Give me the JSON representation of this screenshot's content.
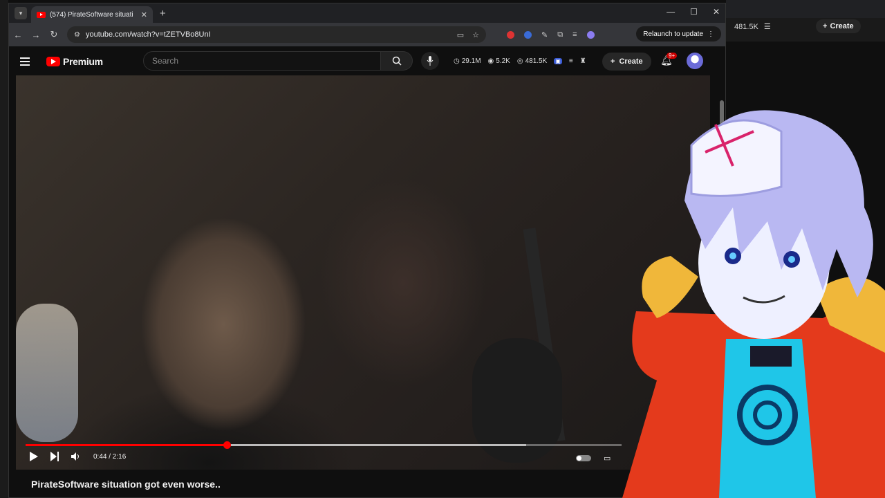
{
  "browser": {
    "tab_title": "(574) PirateSoftware situati",
    "url": "youtube.com/watch?v=tZETVBo8UnI",
    "relaunch_label": "Relaunch to update"
  },
  "youtube": {
    "logo_text": "Premium",
    "search_placeholder": "Search",
    "stats": {
      "views": "29.1M",
      "likes": "5.2K",
      "subs": "481.5K"
    },
    "create_label": "Create",
    "notification_badge": "9+"
  },
  "background_window": {
    "stat": "481.5K",
    "create_label": "Create"
  },
  "player": {
    "time": "0:44 / 2:16",
    "progress_fraction": 0.338,
    "buffer_fraction": 0.84
  },
  "video_title": "PirateSoftware situation got even worse..",
  "colors": {
    "accent": "#ff0000",
    "bg": "#0f0f0f"
  }
}
